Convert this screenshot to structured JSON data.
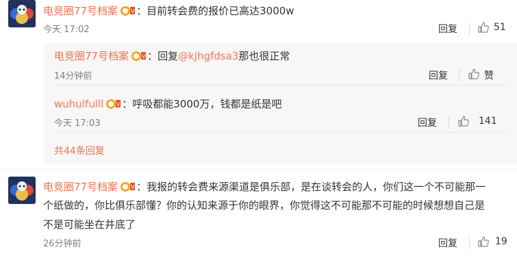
{
  "comments": [
    {
      "author": "电竞圈77号档案",
      "colon": "：",
      "text": "目前转会费的报价已高达3000w",
      "time": "今天 17:02",
      "reply_label": "回复",
      "like_count": "51"
    },
    {
      "author": "电竞圈77号档案",
      "colon": "：",
      "text_line1": "我报的转会费来源渠道是俱乐部，是在谈转会的人，你们这一个不可能那一",
      "text_line2": "个纸做的，你比俱乐部懂？你的认知来源于你的眼界，你觉得这不可能那不可能的时候想想自己是",
      "text_line3": "不是可能坐在井底了",
      "time": "26分钟前",
      "reply_label": "回复",
      "like_count": "19"
    }
  ],
  "replies": [
    {
      "author": "电竞圈77号档案",
      "colon": "：",
      "prefix": "回复",
      "mention": "@kjhgfdsa3",
      "text": "那也很正常",
      "time": "14分钟前",
      "reply_label": "回复",
      "like_label": "赞"
    },
    {
      "author": "wuhulfulll",
      "colon": "：",
      "text": "呼吸都能3000万，钱都是纸是吧",
      "time": "今天 17:03",
      "reply_label": "回复",
      "like_count": "141"
    }
  ],
  "more_replies": "共44条回复",
  "colors": {
    "accent": "#eb7350",
    "reply_bg": "#f7f7f7",
    "time": "#808080"
  },
  "icons": [
    "avatar-image",
    "vip-badge-icon",
    "thumb-up-icon"
  ]
}
